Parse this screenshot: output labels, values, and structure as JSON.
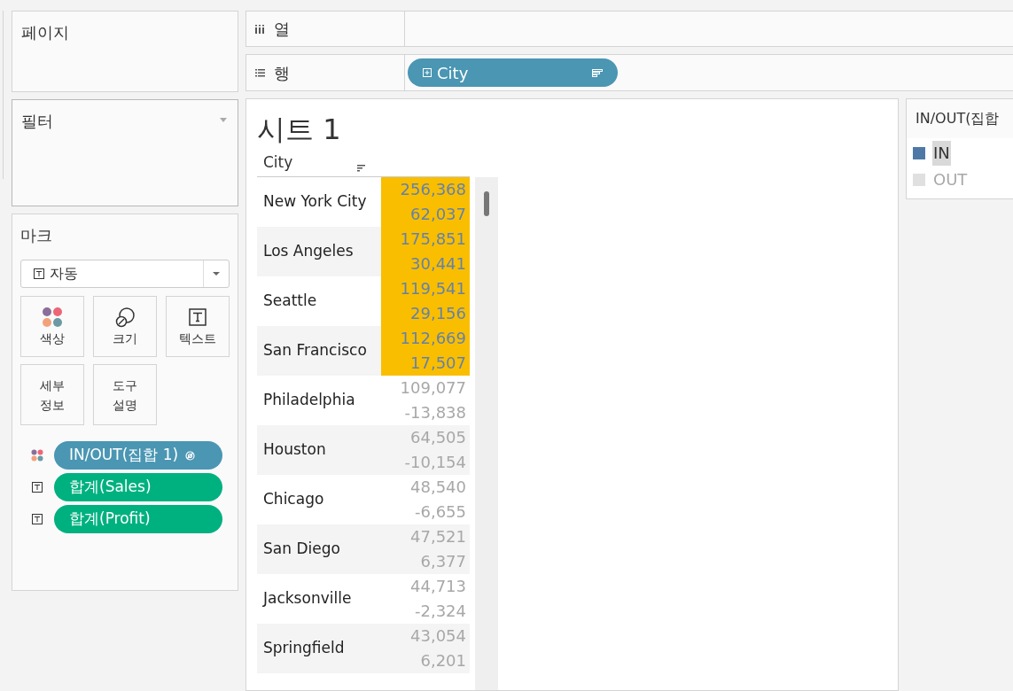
{
  "pages_card": {
    "title": "페이지"
  },
  "filters_card": {
    "title": "필터"
  },
  "marks_card": {
    "title": "마크",
    "mark_type": "자동",
    "buttons": [
      {
        "kind": "color",
        "label": "색상"
      },
      {
        "kind": "size",
        "label": "크기"
      },
      {
        "kind": "text",
        "label": "텍스트"
      },
      {
        "kind": "detail",
        "label": "세부\n정보"
      },
      {
        "kind": "tooltip",
        "label": "도구\n설명"
      }
    ],
    "fields": [
      {
        "kind": "color",
        "label": "IN/OUT(집합 1)",
        "color": "#4a96b3"
      },
      {
        "kind": "text",
        "label": "합계(Sales)",
        "color": "#00b180"
      },
      {
        "kind": "text",
        "label": "합계(Profit)",
        "color": "#00b180"
      }
    ]
  },
  "columns_shelf": {
    "label": "열"
  },
  "rows_shelf": {
    "label": "행",
    "pills": [
      {
        "label": "City"
      }
    ]
  },
  "sheet": {
    "title": "시트 1",
    "column_header": "City",
    "rows": [
      {
        "city": "New York City",
        "sales": "256,368",
        "profit": "62,037",
        "in_set": true
      },
      {
        "city": "Los Angeles",
        "sales": "175,851",
        "profit": "30,441",
        "in_set": true
      },
      {
        "city": "Seattle",
        "sales": "119,541",
        "profit": "29,156",
        "in_set": true
      },
      {
        "city": "San Francisco",
        "sales": "112,669",
        "profit": "17,507",
        "in_set": true
      },
      {
        "city": "Philadelphia",
        "sales": "109,077",
        "profit": "-13,838",
        "in_set": false
      },
      {
        "city": "Houston",
        "sales": "64,505",
        "profit": "-10,154",
        "in_set": false
      },
      {
        "city": "Chicago",
        "sales": "48,540",
        "profit": "-6,655",
        "in_set": false
      },
      {
        "city": "San Diego",
        "sales": "47,521",
        "profit": "6,377",
        "in_set": false
      },
      {
        "city": "Jacksonville",
        "sales": "44,713",
        "profit": "-2,324",
        "in_set": false
      },
      {
        "city": "Springfield",
        "sales": "43,054",
        "profit": "6,201",
        "in_set": false
      }
    ]
  },
  "legend": {
    "title": "IN/OUT(집합",
    "items": [
      {
        "label": "IN",
        "color": "#4e79a7",
        "selected": true
      },
      {
        "label": "OUT",
        "color": "#e0e0e0",
        "selected": false
      }
    ]
  }
}
